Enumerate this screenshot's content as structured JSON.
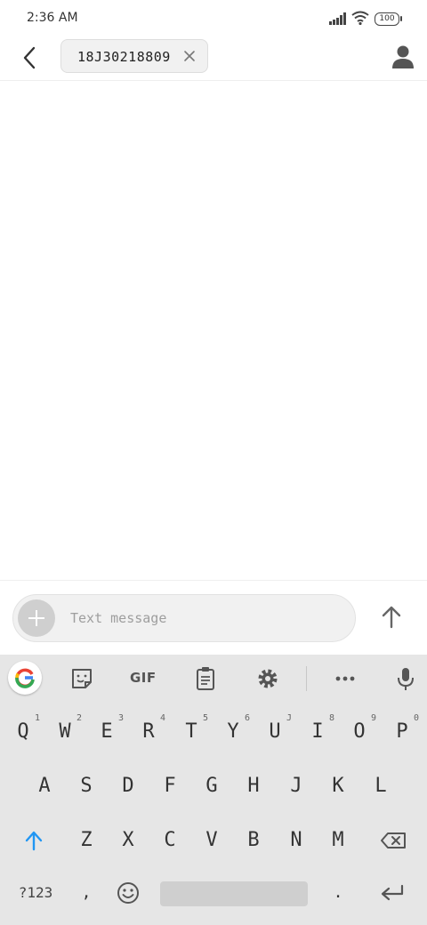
{
  "status": {
    "time": "2:36 AM",
    "battery": "100"
  },
  "header": {
    "recipient": "18J30218809"
  },
  "compose": {
    "placeholder": "Text message"
  },
  "toolbar": {
    "gif_label": "GIF"
  },
  "keyboard": {
    "row1": [
      {
        "label": "Q",
        "hint": "1"
      },
      {
        "label": "W",
        "hint": "2"
      },
      {
        "label": "E",
        "hint": "3"
      },
      {
        "label": "R",
        "hint": "4"
      },
      {
        "label": "T",
        "hint": "5"
      },
      {
        "label": "Y",
        "hint": "6"
      },
      {
        "label": "U",
        "hint": "J"
      },
      {
        "label": "I",
        "hint": "8"
      },
      {
        "label": "O",
        "hint": "9"
      },
      {
        "label": "P",
        "hint": "0"
      }
    ],
    "row2": [
      "A",
      "S",
      "D",
      "F",
      "G",
      "H",
      "J",
      "K",
      "L"
    ],
    "row3": [
      "Z",
      "X",
      "C",
      "V",
      "B",
      "N",
      "M"
    ],
    "symbols_label": "?123",
    "comma": ",",
    "period": "."
  },
  "colors": {
    "shift_accent": "#2196f3",
    "keyboard_bg": "#e6e6e6"
  }
}
